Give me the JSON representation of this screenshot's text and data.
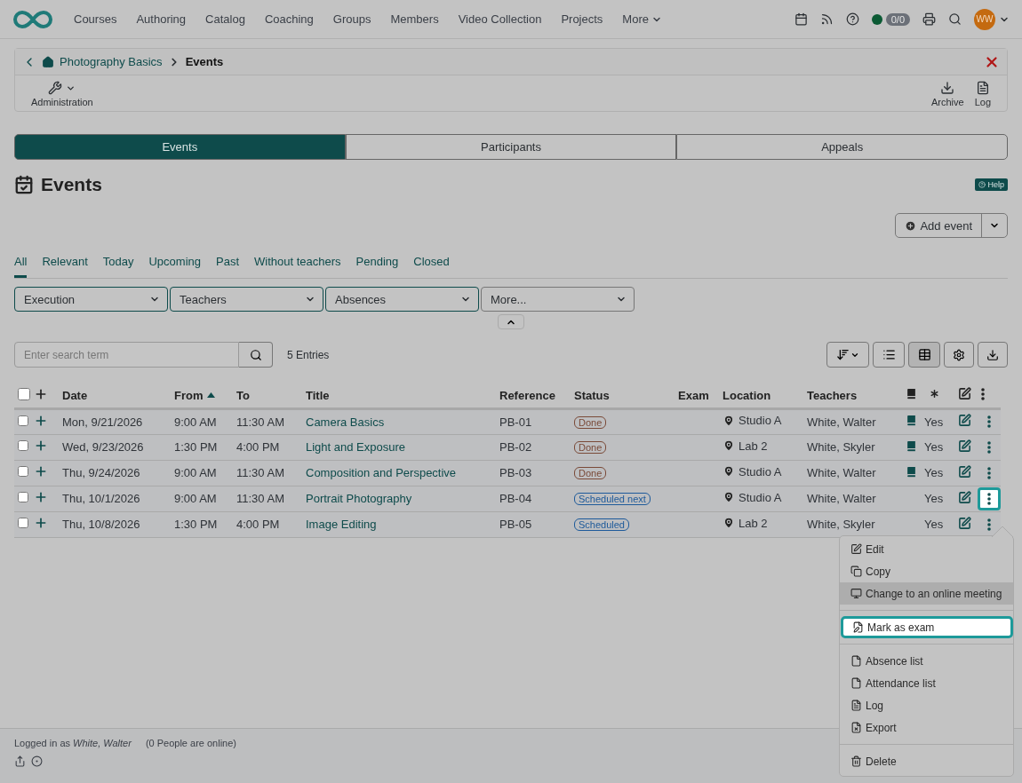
{
  "nav": {
    "items": [
      "Courses",
      "Authoring",
      "Catalog",
      "Coaching",
      "Groups",
      "Members",
      "Video Collection",
      "Projects"
    ],
    "more": "More",
    "counter": "0/0",
    "avatar": "WW",
    "online": true
  },
  "breadcrumb": {
    "parent": "Photography Basics",
    "current": "Events"
  },
  "toolbar": {
    "left": [
      {
        "label": "Administration",
        "kind": "wrench"
      }
    ],
    "right": [
      {
        "label": "Archive",
        "kind": "archive"
      },
      {
        "label": "Log",
        "kind": "log"
      }
    ]
  },
  "tabs": [
    {
      "label": "Events",
      "selected": true
    },
    {
      "label": "Participants",
      "selected": false
    },
    {
      "label": "Appeals",
      "selected": false
    }
  ],
  "title": "Events",
  "help": "Help",
  "add_button": "Add event",
  "filter_tabs": [
    {
      "label": "All",
      "selected": true
    },
    {
      "label": "Relevant",
      "selected": false
    },
    {
      "label": "Today",
      "selected": false
    },
    {
      "label": "Upcoming",
      "selected": false
    },
    {
      "label": "Past",
      "selected": false
    },
    {
      "label": "Without teachers",
      "selected": false
    },
    {
      "label": "Pending",
      "selected": false
    },
    {
      "label": "Closed",
      "selected": false
    }
  ],
  "filters": [
    "Execution",
    "Teachers",
    "Absences",
    "More..."
  ],
  "search": {
    "placeholder": "Enter search term"
  },
  "entries": "5 Entries",
  "table": {
    "all_checked": false,
    "columns": [
      {
        "label": "Date",
        "sorted": false
      },
      {
        "label": "From",
        "sorted": true
      },
      {
        "label": "To",
        "sorted": false
      },
      {
        "label": "Title",
        "sorted": false
      },
      {
        "label": "Reference",
        "sorted": false
      },
      {
        "label": "Status",
        "sorted": false
      },
      {
        "label": "Exam",
        "sorted": false
      },
      {
        "label": "Location",
        "sorted": false
      },
      {
        "label": "Teachers",
        "sorted": false
      }
    ],
    "rows": [
      {
        "date": "Mon, 9/21/2026",
        "from": "9:00 AM",
        "to": "11:30 AM",
        "title": "Camera Basics",
        "reference": "PB-01",
        "status": {
          "label": "Done",
          "kind": "done"
        },
        "location": "Studio A",
        "teachers": "White, Walter",
        "book": true,
        "flag": "Yes",
        "checked": false,
        "focused": false
      },
      {
        "date": "Wed, 9/23/2026",
        "from": "1:30 PM",
        "to": "4:00 PM",
        "title": "Light and Exposure",
        "reference": "PB-02",
        "status": {
          "label": "Done",
          "kind": "done"
        },
        "location": "Lab 2",
        "teachers": "White, Skyler",
        "book": true,
        "flag": "Yes",
        "checked": false,
        "focused": false
      },
      {
        "date": "Thu, 9/24/2026",
        "from": "9:00 AM",
        "to": "11:30 AM",
        "title": "Composition and Perspective",
        "reference": "PB-03",
        "status": {
          "label": "Done",
          "kind": "done"
        },
        "location": "Studio A",
        "teachers": "White, Walter",
        "book": true,
        "flag": "Yes",
        "checked": false,
        "focused": false
      },
      {
        "date": "Thu, 10/1/2026",
        "from": "9:00 AM",
        "to": "11:30 AM",
        "title": "Portrait Photography",
        "reference": "PB-04",
        "status": {
          "label": "Scheduled next",
          "kind": "scheduled"
        },
        "location": "Studio A",
        "teachers": "White, Walter",
        "book": false,
        "flag": "Yes",
        "checked": false,
        "focused": true
      },
      {
        "date": "Thu, 10/8/2026",
        "from": "1:30 PM",
        "to": "4:00 PM",
        "title": "Image Editing",
        "reference": "PB-05",
        "status": {
          "label": "Scheduled",
          "kind": "scheduled"
        },
        "location": "Lab 2",
        "teachers": "White, Skyler",
        "book": false,
        "flag": "Yes",
        "checked": false,
        "focused": false
      }
    ]
  },
  "menu": [
    {
      "kind": "edit",
      "label": "Edit",
      "hovered": false,
      "focused": false
    },
    {
      "kind": "copy",
      "label": "Copy",
      "hovered": false,
      "focused": false
    },
    {
      "kind": "online",
      "label": "Change to an online meeting",
      "hovered": true,
      "focused": false
    },
    {
      "kind": "divider"
    },
    {
      "kind": "exam",
      "label": "Mark as exam",
      "hovered": false,
      "focused": true
    },
    {
      "kind": "divider"
    },
    {
      "kind": "pdf",
      "label": "Absence list",
      "hovered": false,
      "focused": false
    },
    {
      "kind": "pdf",
      "label": "Attendance list",
      "hovered": false,
      "focused": false
    },
    {
      "kind": "log",
      "label": "Log",
      "hovered": false,
      "focused": false
    },
    {
      "kind": "export",
      "label": "Export",
      "hovered": false,
      "focused": false
    },
    {
      "kind": "divider"
    },
    {
      "kind": "delete",
      "label": "Delete",
      "hovered": false,
      "focused": false
    }
  ],
  "footer": {
    "logged_in": "Logged in as *White, Walter*",
    "online": "(0 People are online)"
  }
}
